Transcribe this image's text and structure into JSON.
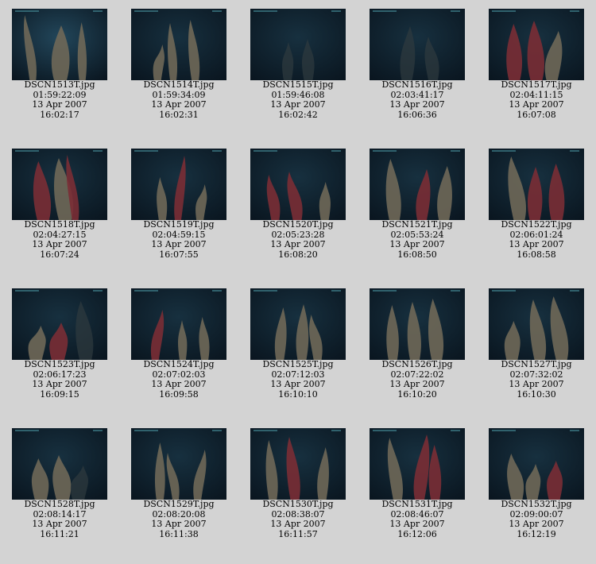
{
  "gallery": {
    "items": [
      {
        "filename": "DSCN1513T.jpg",
        "timecode": "01:59:22:09",
        "date": "13 Apr 2007",
        "time": "16:02:17",
        "style": "light",
        "shapes": [
          "pale",
          "pale",
          "pale"
        ]
      },
      {
        "filename": "DSCN1514T.jpg",
        "timecode": "01:59:34:09",
        "date": "13 Apr 2007",
        "time": "16:02:31",
        "style": "dark",
        "shapes": [
          "pale",
          "pale",
          "pale"
        ]
      },
      {
        "filename": "DSCN1515T.jpg",
        "timecode": "01:59:46:08",
        "date": "13 Apr 2007",
        "time": "16:02:42",
        "style": "dark",
        "shapes": [
          "faint",
          "faint"
        ]
      },
      {
        "filename": "DSCN1516T.jpg",
        "timecode": "02:03:41:17",
        "date": "13 Apr 2007",
        "time": "16:06:36",
        "style": "dark",
        "shapes": [
          "faint",
          "faint"
        ]
      },
      {
        "filename": "DSCN1517T.jpg",
        "timecode": "02:04:11:15",
        "date": "13 Apr 2007",
        "time": "16:07:08",
        "style": "dark",
        "shapes": [
          "red",
          "red",
          "pale"
        ]
      },
      {
        "filename": "DSCN1518T.jpg",
        "timecode": "02:04:27:15",
        "date": "13 Apr 2007",
        "time": "16:07:24",
        "style": "dark",
        "shapes": [
          "red",
          "pale",
          "red"
        ]
      },
      {
        "filename": "DSCN1519T.jpg",
        "timecode": "02:04:59:15",
        "date": "13 Apr 2007",
        "time": "16:07:55",
        "style": "dark",
        "shapes": [
          "pale",
          "red",
          "pale"
        ]
      },
      {
        "filename": "DSCN1520T.jpg",
        "timecode": "02:05:23:28",
        "date": "13 Apr 2007",
        "time": "16:08:20",
        "style": "dark",
        "shapes": [
          "red",
          "red",
          "pale"
        ]
      },
      {
        "filename": "DSCN1521T.jpg",
        "timecode": "02:05:53:24",
        "date": "13 Apr 2007",
        "time": "16:08:50",
        "style": "dark",
        "shapes": [
          "pale",
          "red",
          "pale"
        ]
      },
      {
        "filename": "DSCN1522T.jpg",
        "timecode": "02:06:01:24",
        "date": "13 Apr 2007",
        "time": "16:08:58",
        "style": "dark",
        "shapes": [
          "pale",
          "red",
          "red"
        ]
      },
      {
        "filename": "DSCN1523T.jpg",
        "timecode": "02:06:17:23",
        "date": "13 Apr 2007",
        "time": "16:09:15",
        "style": "dark",
        "shapes": [
          "pale",
          "red",
          "faint"
        ]
      },
      {
        "filename": "DSCN1524T.jpg",
        "timecode": "02:07:02:03",
        "date": "13 Apr 2007",
        "time": "16:09:58",
        "style": "dark",
        "shapes": [
          "red",
          "pale",
          "pale"
        ]
      },
      {
        "filename": "DSCN1525T.jpg",
        "timecode": "02:07:12:03",
        "date": "13 Apr 2007",
        "time": "16:10:10",
        "style": "dark",
        "shapes": [
          "pale",
          "pale",
          "pale"
        ]
      },
      {
        "filename": "DSCN1526T.jpg",
        "timecode": "02:07:22:02",
        "date": "13 Apr 2007",
        "time": "16:10:20",
        "style": "dark",
        "shapes": [
          "pale",
          "pale",
          "pale"
        ]
      },
      {
        "filename": "DSCN1527T.jpg",
        "timecode": "02:07:32:02",
        "date": "13 Apr 2007",
        "time": "16:10:30",
        "style": "dark",
        "shapes": [
          "pale",
          "pale",
          "pale"
        ]
      },
      {
        "filename": "DSCN1528T.jpg",
        "timecode": "02:08:14:17",
        "date": "13 Apr 2007",
        "time": "16:11:21",
        "style": "dark",
        "shapes": [
          "pale",
          "pale",
          "faint"
        ]
      },
      {
        "filename": "DSCN1529T.jpg",
        "timecode": "02:08:20:08",
        "date": "13 Apr 2007",
        "time": "16:11:38",
        "style": "dark",
        "shapes": [
          "pale",
          "pale",
          "pale"
        ]
      },
      {
        "filename": "DSCN1530T.jpg",
        "timecode": "02:08:38:07",
        "date": "13 Apr 2007",
        "time": "16:11:57",
        "style": "dark",
        "shapes": [
          "pale",
          "red",
          "pale"
        ]
      },
      {
        "filename": "DSCN1531T.jpg",
        "timecode": "02:08:46:07",
        "date": "13 Apr 2007",
        "time": "16:12:06",
        "style": "dark",
        "shapes": [
          "pale",
          "red",
          "red"
        ]
      },
      {
        "filename": "DSCN1532T.jpg",
        "timecode": "02:09:00:07",
        "date": "13 Apr 2007",
        "time": "16:12:19",
        "style": "dark",
        "shapes": [
          "pale",
          "pale",
          "red"
        ]
      }
    ]
  },
  "colors": {
    "background": "#d3d3d3",
    "water_light": "#17303f",
    "water_dark": "#0a1620",
    "pale_tentacle": "#6f6858",
    "red_tentacle": "#7a2e35",
    "faint_tentacle": "#2f3a3e"
  }
}
